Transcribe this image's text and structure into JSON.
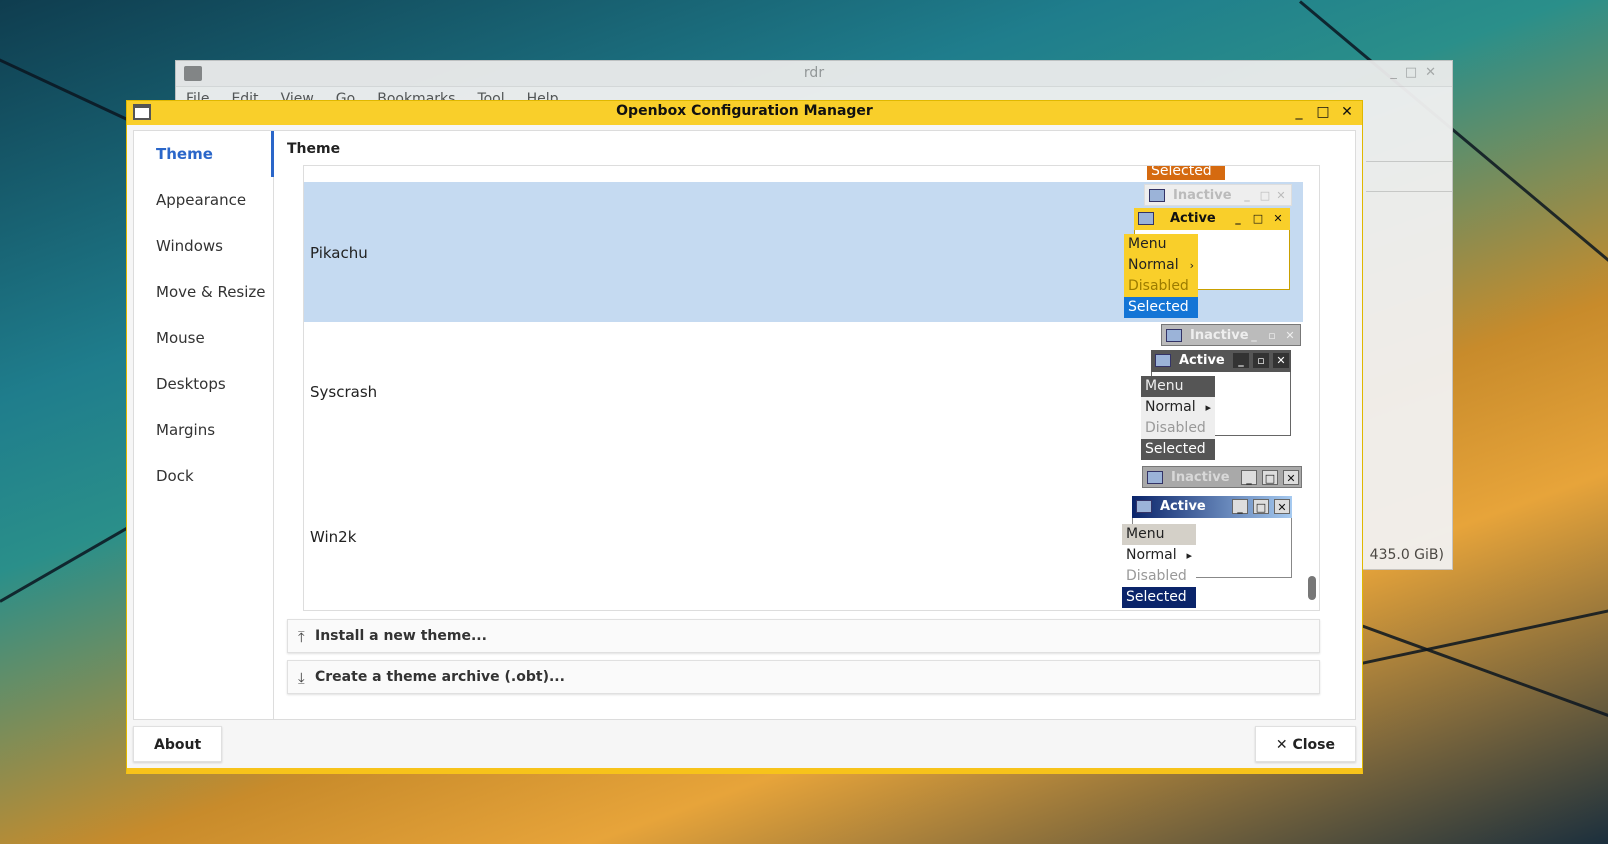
{
  "background_window": {
    "title": "rdr",
    "menu": [
      "File",
      "Edit",
      "View",
      "Go",
      "Bookmarks",
      "Tool",
      "Help"
    ],
    "status": "435.0 GiB)"
  },
  "dialog": {
    "title": "Openbox Configuration Manager",
    "controls": {
      "minimize": "_",
      "maximize": "□",
      "close": "✕"
    }
  },
  "sidebar": {
    "items": [
      {
        "label": "Theme",
        "active": true
      },
      {
        "label": "Appearance"
      },
      {
        "label": "Windows"
      },
      {
        "label": "Move & Resize"
      },
      {
        "label": "Mouse"
      },
      {
        "label": "Desktops"
      },
      {
        "label": "Margins"
      },
      {
        "label": "Dock"
      }
    ]
  },
  "panel": {
    "title": "Theme",
    "themes": [
      {
        "name": "Pikachu",
        "selected": true
      },
      {
        "name": "Syscrash",
        "selected": false
      },
      {
        "name": "Win2k",
        "selected": false
      }
    ],
    "previous_selected_label": "Selected",
    "preview": {
      "inactive": "Inactive",
      "active": "Active",
      "menu": "Menu",
      "normal": "Normal",
      "disabled": "Disabled",
      "selected": "Selected"
    },
    "install_button": "Install a new theme...",
    "archive_button": "Create a theme archive (.obt)..."
  },
  "footer": {
    "about": "About",
    "close": "Close",
    "close_icon": "✕"
  },
  "colors": {
    "titlebar": "#f9cf2a",
    "accent": "#2a66c9",
    "selection": "#c5daf1"
  }
}
